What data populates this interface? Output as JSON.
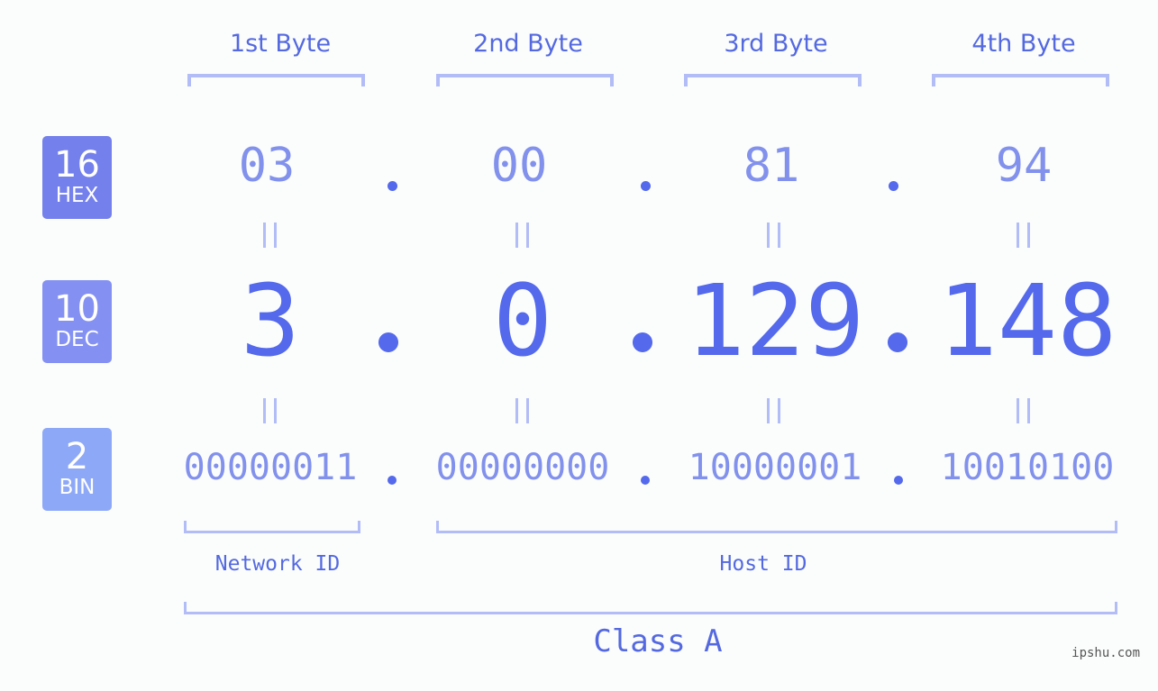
{
  "bytes": [
    {
      "label": "1st Byte",
      "hex": "03",
      "dec": "3",
      "bin": "00000011"
    },
    {
      "label": "2nd Byte",
      "hex": "00",
      "dec": "0",
      "bin": "00000000"
    },
    {
      "label": "3rd Byte",
      "hex": "81",
      "dec": "129",
      "bin": "10000001"
    },
    {
      "label": "4th Byte",
      "hex": "94",
      "dec": "148",
      "bin": "10010100"
    }
  ],
  "badges": {
    "hex": {
      "num": "16",
      "txt": "HEX",
      "color": "#7480ec"
    },
    "dec": {
      "num": "10",
      "txt": "DEC",
      "color": "#8491f2"
    },
    "bin": {
      "num": "2",
      "txt": "BIN",
      "color": "#8ea8f8"
    }
  },
  "separator": ".",
  "equals_symbol": "||",
  "network_id_label": "Network ID",
  "host_id_label": "Host ID",
  "class_label": "Class A",
  "watermark": "ipshu.com",
  "colors": {
    "accent": "#5469ec",
    "light": "#8291ec",
    "bracket": "#b2bcf6",
    "background": "#fbfdfc"
  }
}
